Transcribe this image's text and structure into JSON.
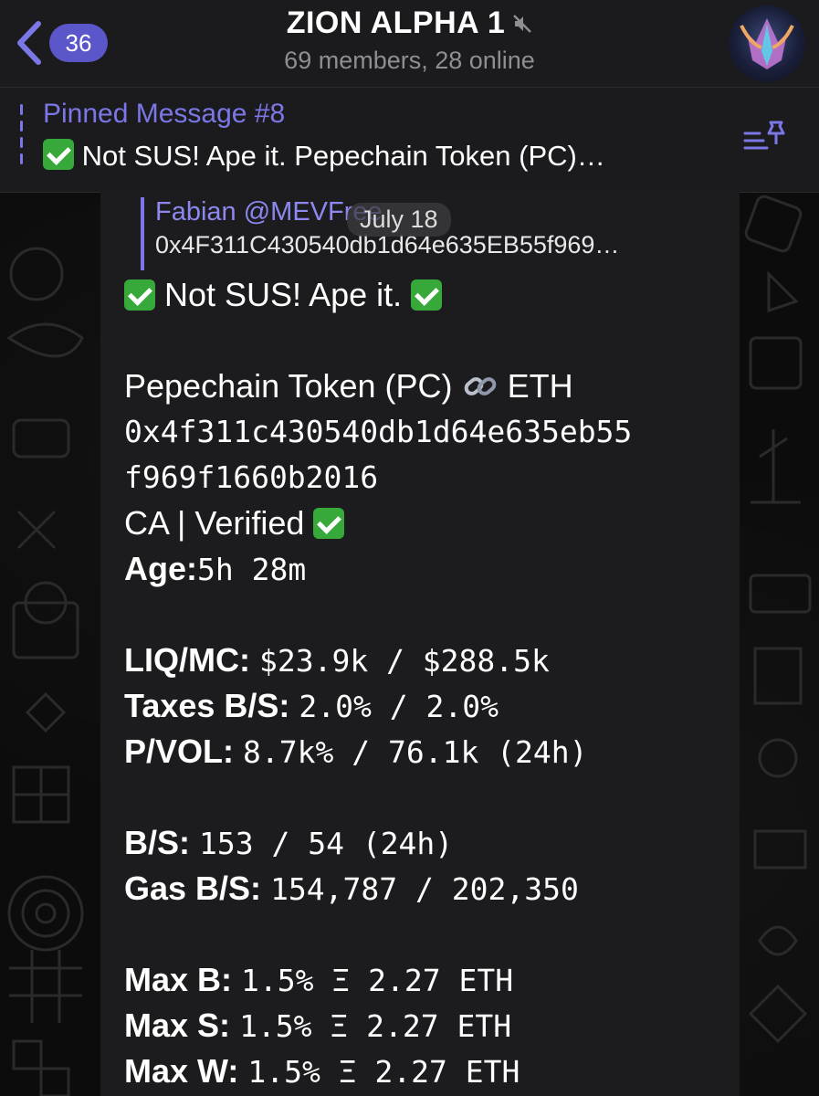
{
  "header": {
    "back_count": "36",
    "title": "ZION ALPHA 1",
    "subtitle": "69 members, 28 online"
  },
  "pinned": {
    "title": "Pinned Message #8",
    "text": "Not SUS! Ape it.  Pepechain Token (PC)…"
  },
  "quote": {
    "name": "Fabian @MEVFree",
    "text": "0x4F311C430540db1d64e635EB55f969…"
  },
  "date_pill": "July 18",
  "message": {
    "headline": "Not SUS! Ape it.",
    "token_name": "Pepechain Token (PC)",
    "chain": "ETH",
    "address_line1": "0x4f311c430540db1d64e635eb55",
    "address_line2": "f969f1660b2016",
    "ca_status": "CA | Verified",
    "rows": [
      {
        "label": "Age:",
        "value": "5h 28m"
      },
      {
        "label": "LIQ/MC:",
        "value": "$23.9k / $288.5k"
      },
      {
        "label": "Taxes B/S:",
        "value": "2.0% / 2.0%"
      },
      {
        "label": "P/VOL:",
        "value": "8.7k% / 76.1k (24h)"
      },
      {
        "label": "B/S:",
        "value": "153 / 54 (24h)"
      },
      {
        "label": "Gas B/S:",
        "value": "154,787 / 202,350"
      },
      {
        "label": "Max B:",
        "value": "1.5% Ξ 2.27 ETH"
      },
      {
        "label": "Max S:",
        "value": "1.5% Ξ 2.27 ETH"
      },
      {
        "label": "Max W:",
        "value": "1.5% Ξ 2.27 ETH"
      }
    ]
  },
  "colors": {
    "accent": "#7b77e6",
    "badge": "#5b56c9",
    "check": "#36a93a"
  }
}
